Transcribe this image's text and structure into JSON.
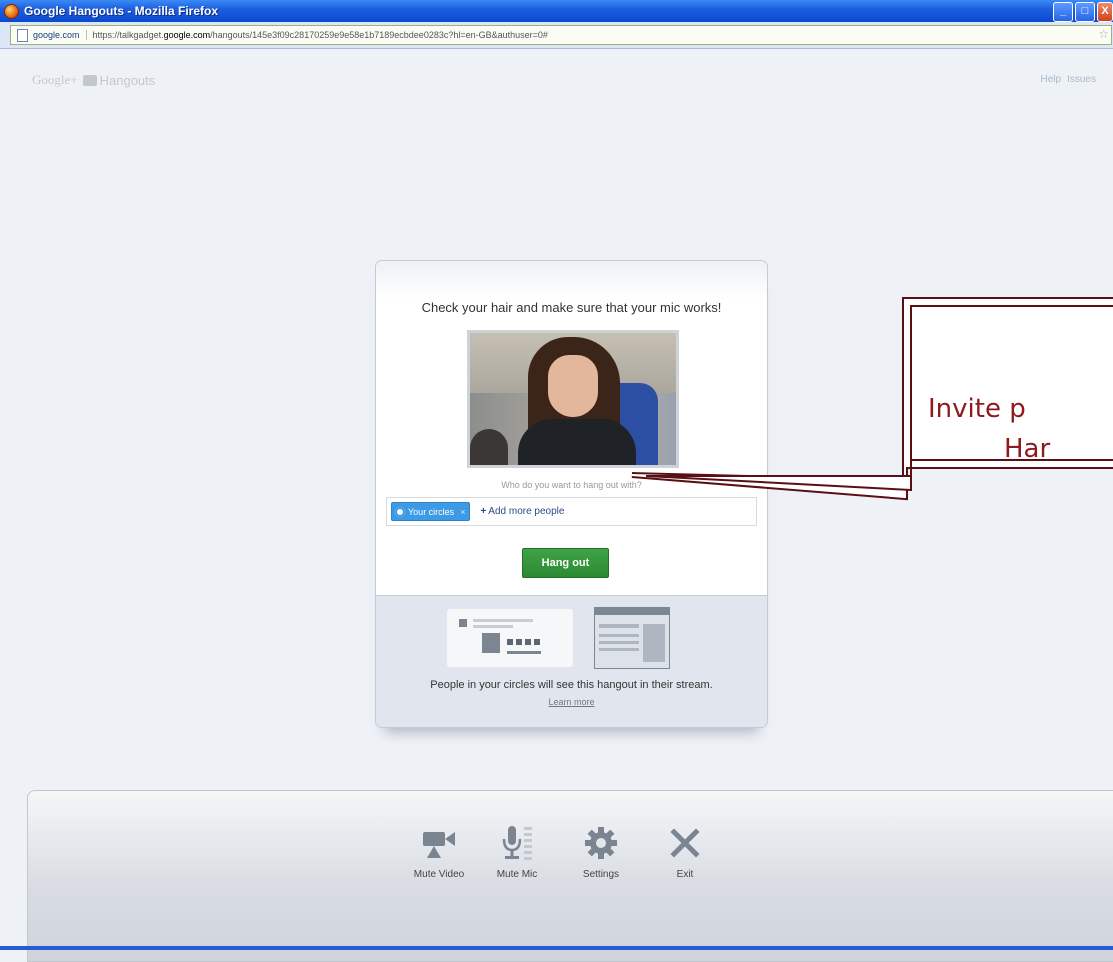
{
  "window": {
    "title": "Google Hangouts - Mozilla Firefox",
    "buttons": [
      "_",
      "□",
      "X"
    ]
  },
  "addressbar": {
    "site": "google.com",
    "url_prefix": "https://talkgadget.",
    "url_domain": "google.com",
    "url_suffix": "/hangouts/145e3f09c28170259e9e58e1b7189ecbdee0283c?hl=en-GB&authuser=0#"
  },
  "header": {
    "logo_text": "Google+",
    "logo_product": "Hangouts",
    "links": [
      "Help",
      "Issues"
    ]
  },
  "dialog": {
    "heading": "Check your hair and make sure that your mic works!",
    "who_label": "Who do you want to hang out with?",
    "chip_label": "Your circles",
    "chip_close": "×",
    "add_people": "Add more people",
    "add_plus": "+",
    "hangout_button": "Hang out",
    "stream_text": "People in your circles will see this hangout in their stream.",
    "learn_more": "Learn more"
  },
  "callout": {
    "line1": "Invite p",
    "line2": "Har"
  },
  "toolbar": {
    "items": [
      {
        "label": "Mute Video",
        "icon": "video-camera-icon"
      },
      {
        "label": "Mute Mic",
        "icon": "microphone-icon"
      },
      {
        "label": "Settings",
        "icon": "gear-icon"
      },
      {
        "label": "Exit",
        "icon": "close-icon"
      }
    ]
  },
  "colors": {
    "hangout_button": "#2b8a33",
    "callout_border": "#5a0f14",
    "callout_text": "#8e1a20",
    "chip": "#3d9ae4"
  }
}
